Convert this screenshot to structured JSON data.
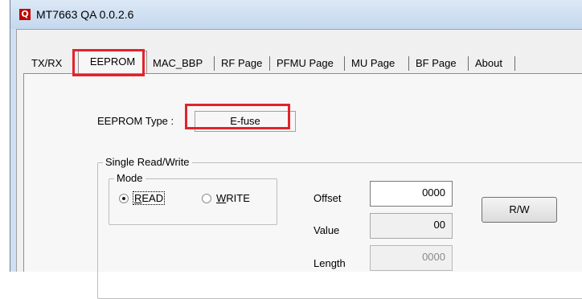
{
  "window": {
    "title": "MT7663 QA 0.0.2.6",
    "icon_glyph": "Q"
  },
  "tabs": [
    {
      "label": "TX/RX",
      "active": false
    },
    {
      "label": "EEPROM",
      "active": true
    },
    {
      "label": "MAC_BBP",
      "active": false
    },
    {
      "label": "RF Page",
      "active": false
    },
    {
      "label": "PFMU Page",
      "active": false
    },
    {
      "label": "MU Page",
      "active": false
    },
    {
      "label": "BF Page",
      "active": false
    },
    {
      "label": "About",
      "active": false
    }
  ],
  "eeprom": {
    "type_label": "EEPROM Type :",
    "type_value": "E-fuse"
  },
  "single_rw": {
    "legend": "Single Read/Write",
    "mode_legend": "Mode",
    "read_label_u": "R",
    "read_label_rest": "EAD",
    "write_label_u": "W",
    "write_label_rest": "RITE",
    "selected_mode": "READ",
    "offset_label": "Offset",
    "offset_value": "0000",
    "value_label": "Value",
    "value_value": "00",
    "length_label": "Length",
    "length_value": "0000",
    "rw_button": "R/W"
  },
  "colors": {
    "highlight": "#e3232b",
    "window_frame": "#cfe0f2",
    "icon": "#c00000"
  }
}
